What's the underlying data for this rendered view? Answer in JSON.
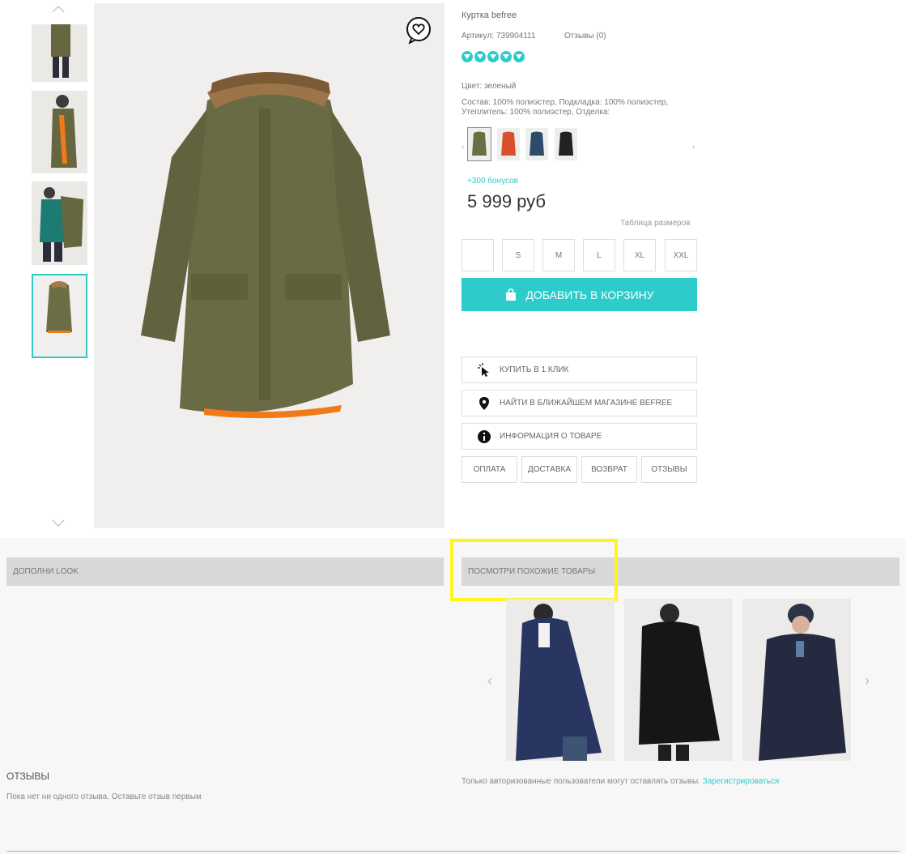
{
  "product": {
    "title": "Куртка befree",
    "article": "Артикул: 739904111",
    "reviews_link": "Отзывы (0)",
    "rating": 5,
    "color": "Цвет: зеленый",
    "composition_line1": "Состав: 100% полиэстер, Подкладка: 100% полиэстер,",
    "composition_line2": "Утеплитель: 100% полиэстер, Отделка:",
    "bonus": "+300 бонусов",
    "price": "5 999 руб",
    "size_table": "Таблица размеров",
    "sizes": [
      "",
      "S",
      "M",
      "L",
      "XL",
      "XXL"
    ],
    "add_to_cart": "ДОБАВИТЬ В КОРЗИНУ",
    "buy_one_click": "КУПИТЬ В 1 КЛИК",
    "find_store": "НАЙТИ В БЛИЖАЙШЕМ МАГАЗИНЕ BEFREE",
    "product_info": "ИНФОРМАЦИЯ О ТОВАРЕ",
    "tabs": [
      "ОПЛАТА",
      "ДОСТАВКА",
      "ВОЗВРАТ",
      "ОТЗЫВЫ"
    ]
  },
  "sections": {
    "complete_look": "ДОПОЛНИ LOOK",
    "similar": "ПОСМОТРИ ПОХОЖИЕ ТОВАРЫ"
  },
  "reviews": {
    "title": "ОТЗЫВЫ",
    "empty": "Пока нет ни одного отзыва. Оставьте отзыв первым",
    "auth_note": "Только авторизованные пользователи могут оставлять отзывы.",
    "register_link": "Зарегистрироваться"
  },
  "colors": {
    "accent": "#2ecbcb",
    "highlight": "#fff41f",
    "swatches": [
      "#6b6d45",
      "#d9502e",
      "#2c4b6a",
      "#222222"
    ]
  }
}
